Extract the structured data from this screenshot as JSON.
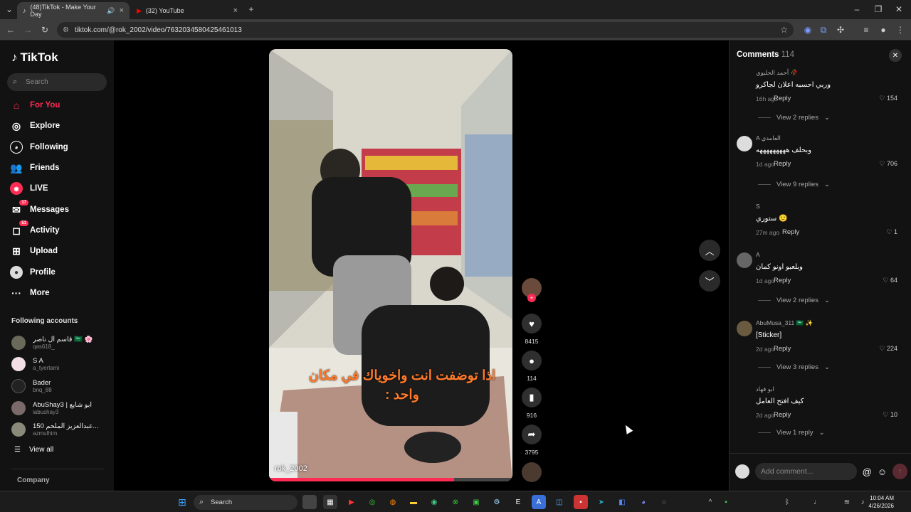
{
  "browser": {
    "tabs": [
      {
        "label": "(48)TikTok - Make Your Day",
        "active": true
      },
      {
        "label": "(32) YouTube",
        "active": false
      }
    ],
    "url": "tiktok.com/@rok_2002/video/7632034580425461013"
  },
  "sidebar": {
    "logo": "TikTok",
    "search_placeholder": "Search",
    "nav": [
      {
        "label": "For You",
        "icon": "home-icon",
        "active": true
      },
      {
        "label": "Explore",
        "icon": "compass-icon"
      },
      {
        "label": "Following",
        "icon": "following-icon"
      },
      {
        "label": "Friends",
        "icon": "friends-icon"
      },
      {
        "label": "LIVE",
        "icon": "live-icon"
      },
      {
        "label": "Messages",
        "icon": "messages-icon",
        "badge": "17"
      },
      {
        "label": "Activity",
        "icon": "activity-icon",
        "badge": "51"
      },
      {
        "label": "Upload",
        "icon": "upload-icon"
      },
      {
        "label": "Profile",
        "icon": "profile-icon"
      },
      {
        "label": "More",
        "icon": "more-icon"
      }
    ],
    "following_title": "Following accounts",
    "accounts": [
      {
        "name": "قاسم آل ناصر 🇸🇦 🌸",
        "user": "qas618_"
      },
      {
        "name": "S A",
        "user": "a_tyertami"
      },
      {
        "name": "Bader",
        "user": "bnq_88"
      },
      {
        "name": "AbuShay3 | ابو شايع",
        "user": "iabushay3"
      },
      {
        "name": "150 عبدالعزيز الملحم...",
        "user": "azmulhim"
      }
    ],
    "view_all": "View all",
    "company": "Company"
  },
  "video": {
    "caption": "اذا توضفت انت واخوياك في مكان واحد :",
    "username": "rok_2002",
    "actions": [
      {
        "icon": "heart-icon",
        "count": "8415"
      },
      {
        "icon": "comment-icon",
        "count": "114"
      },
      {
        "icon": "bookmark-icon",
        "count": "916"
      },
      {
        "icon": "share-icon",
        "count": "3795"
      }
    ]
  },
  "comments": {
    "title": "Comments",
    "count": "114",
    "items": [
      {
        "name": "أحمد الحليوي 🥀",
        "text": "وربي احسبه اعلان لجاكرو",
        "date": "16h ago",
        "reply": "Reply",
        "likes": "154",
        "view_replies": "View 2 replies"
      },
      {
        "name": "A العامدي",
        "text": "وبحلف هههههههههه",
        "date": "1d ago",
        "reply": "Reply",
        "likes": "706",
        "view_replies": "View 9 replies"
      },
      {
        "name": "S",
        "text": "ستوري 🙂",
        "date": "27m ago",
        "reply": "Reply",
        "likes": "1",
        "view_replies": ""
      },
      {
        "name": "A",
        "text": "وبلعبو اونو كمان",
        "date": "1d ago",
        "reply": "Reply",
        "likes": "64",
        "view_replies": "View 2 replies"
      },
      {
        "name": "AbuMusa_311 🇸🇦 ✨",
        "text": "[Sticker]",
        "date": "2d ago",
        "reply": "Reply",
        "likes": "224",
        "view_replies": "View 3 replies"
      },
      {
        "name": "ابو فهاد",
        "text": "كيف افتح العامل",
        "date": "2d ago",
        "reply": "Reply",
        "likes": "10",
        "view_replies": "View 1 reply"
      }
    ],
    "input_placeholder": "Add comment..."
  },
  "taskbar": {
    "search": "Search",
    "time": "10:04 AM",
    "date": "4/26/2026"
  }
}
